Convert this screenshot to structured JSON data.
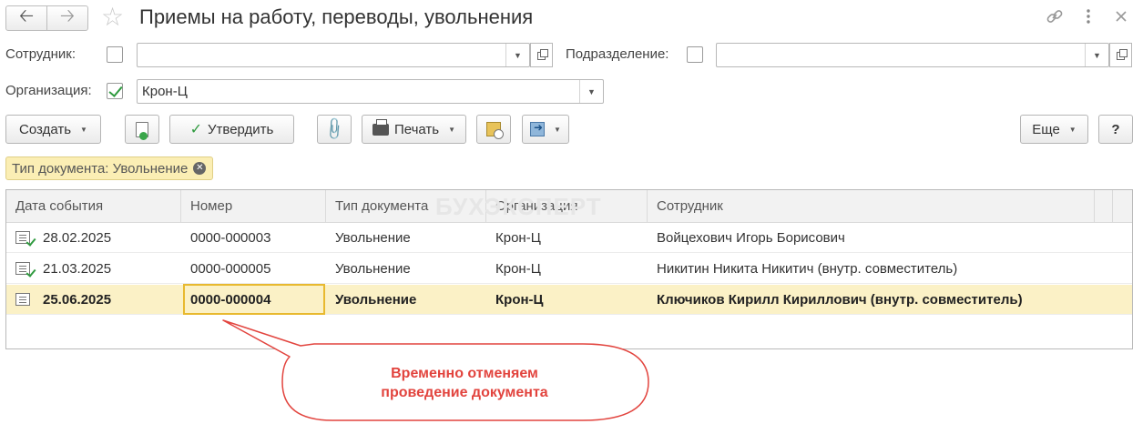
{
  "window": {
    "title": "Приемы на работу, переводы, увольнения",
    "back_icon": "arrow-left-icon",
    "forward_icon": "arrow-right-icon",
    "favorite_icon": "star-icon",
    "link_icon": "link-icon",
    "more_icon": "more-vertical-icon",
    "close_icon": "close-icon"
  },
  "filters": {
    "employee_label": "Сотрудник:",
    "employee_checked": false,
    "employee_value": "",
    "department_label": "Подразделение:",
    "department_checked": false,
    "department_value": "",
    "org_label": "Организация:",
    "org_checked": true,
    "org_value": "Крон-Ц"
  },
  "toolbar": {
    "create": "Создать",
    "approve": "Утвердить",
    "print": "Печать",
    "more": "Еще",
    "help": "?"
  },
  "filter_tag": {
    "text": "Тип документа: Увольнение"
  },
  "table": {
    "columns": [
      "Дата события",
      "Номер",
      "Тип документа",
      "Организация",
      "Сотрудник"
    ],
    "rows": [
      {
        "date": "28.02.2025",
        "number": "0000-000003",
        "type": "Увольнение",
        "org": "Крон-Ц",
        "employee": "Войцехович Игорь Борисович",
        "posted": true,
        "selected": false
      },
      {
        "date": "21.03.2025",
        "number": "0000-000005",
        "type": "Увольнение",
        "org": "Крон-Ц",
        "employee": "Никитин Никита Никитич (внутр. совместитель)",
        "posted": true,
        "selected": false
      },
      {
        "date": "25.06.2025",
        "number": "0000-000004",
        "type": "Увольнение",
        "org": "Крон-Ц",
        "employee": "Ключиков Кирилл Кириллович (внутр. совместитель)",
        "posted": false,
        "selected": true
      }
    ]
  },
  "watermark": "БУХЭКСПЕРТ",
  "callout": {
    "line1": "Временно отменяем",
    "line2": "проведение документа",
    "color": "#e2443e"
  },
  "colors": {
    "selected_row": "#fbf1c6",
    "focus_border": "#e8b92f",
    "filter_tag": "#fbeeb4",
    "check_green": "#2f9a3f"
  }
}
